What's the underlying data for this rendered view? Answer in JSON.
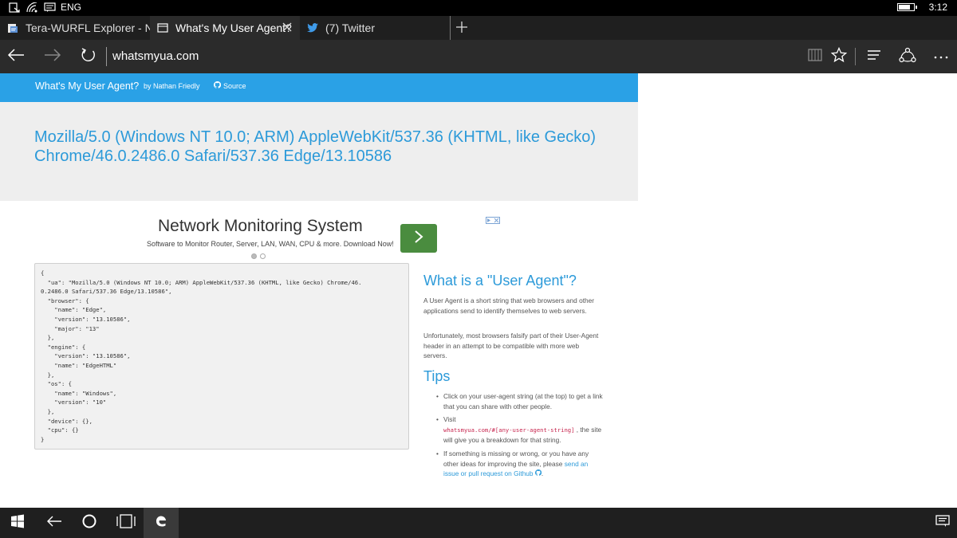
{
  "statusbar": {
    "language": "ENG",
    "time": "3:12",
    "battery_level": 0.8
  },
  "tabs": [
    {
      "title": "Tera-WURFL Explorer - Nok",
      "icon": "page-favicon-icon"
    },
    {
      "title": "What's My User Agent?",
      "icon": "tab-preview-icon",
      "active": true
    },
    {
      "title": "(7) Twitter",
      "icon": "twitter-bird-icon"
    }
  ],
  "navbar": {
    "address": "whatsmyua.com"
  },
  "site": {
    "brand": "What's My User Agent?",
    "author": "by Nathan Friedly",
    "source": "Source"
  },
  "hero": {
    "ua_line1": "Mozilla/5.0 (Windows NT 10.0; ARM) AppleWebKit/537.36 (KHTML, like Gecko)",
    "ua_line2": "Chrome/46.0.2486.0 Safari/537.36 Edge/13.10586"
  },
  "ad": {
    "title": "Network Monitoring System",
    "subtitle": "Software to Monitor Router, Server, LAN, WAN, CPU & more. Download Now!"
  },
  "code_lines": [
    "{",
    "  \"ua\": \"Mozilla/5.0 (Windows NT 10.0; ARM) AppleWebKit/537.36 (KHTML, like Gecko) Chrome/46.",
    "0.2486.0 Safari/537.36 Edge/13.10586\",",
    "  \"browser\": {",
    "    \"name\": \"Edge\",",
    "    \"version\": \"13.10586\",",
    "    \"major\": \"13\"",
    "  },",
    "  \"engine\": {",
    "    \"version\": \"13.10586\",",
    "    \"name\": \"EdgeHTML\"",
    "  },",
    "  \"os\": {",
    "    \"name\": \"Windows\",",
    "    \"version\": \"10\"",
    "  },",
    "  \"device\": {},",
    "  \"cpu\": {}",
    "}"
  ],
  "sidebar": {
    "what_heading": "What is a \"User Agent\"?",
    "what_p1": "A User Agent is a short string that web browsers and other applications send to identify themselves to web servers.",
    "what_p2": "Unfortunately, most browsers falsify part of their User-Agent header in an attempt to be compatible with more web servers.",
    "tips_heading": "Tips",
    "tip1": "Click on your user-agent string (at the top) to get a link that you can share with other people.",
    "tip2_prefix": "Visit",
    "tip2_code": "whatsmyua.com/#[any-user-agent-string]",
    "tip2_suffix": ", the site will give you a breakdown for that string.",
    "tip3_text": "If something is missing or wrong, or you have any other ideas for improving the site, please ",
    "tip3_link": "send an issue or pull request on Github",
    "tip3_end": "."
  }
}
